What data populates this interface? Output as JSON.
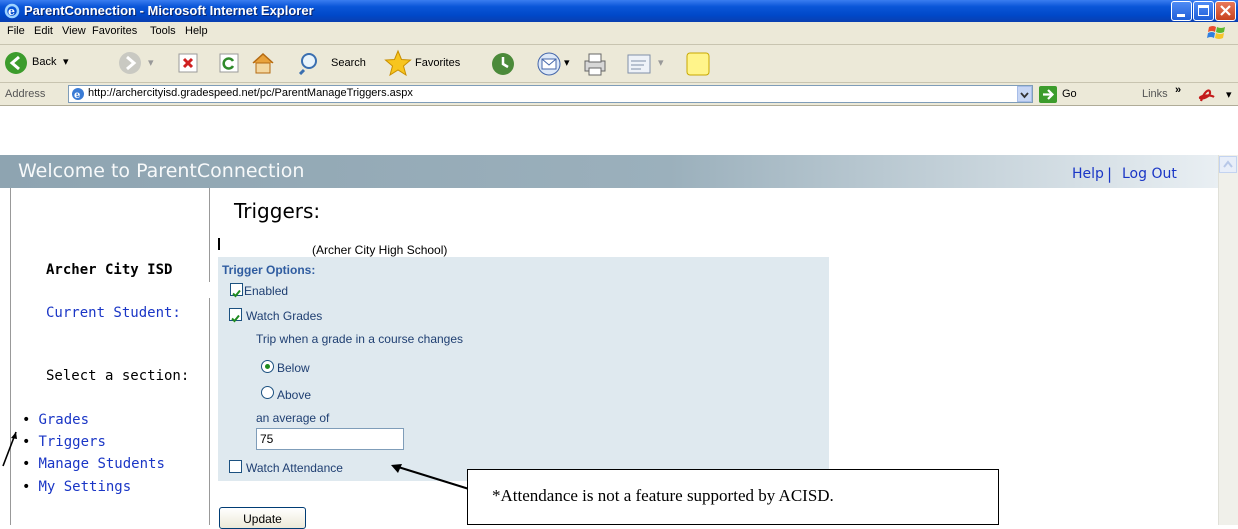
{
  "window": {
    "title": "ParentConnection - Microsoft Internet Explorer"
  },
  "menu": [
    "File",
    "Edit",
    "View",
    "Favorites",
    "Tools",
    "Help"
  ],
  "toolbar": {
    "back_label": "Back",
    "search_label": "Search",
    "favorites_label": "Favorites"
  },
  "address": {
    "label": "Address",
    "url": "http://archercityisd.gradespeed.net/pc/ParentManageTriggers.aspx",
    "go_label": "Go",
    "links_label": "Links"
  },
  "header": {
    "welcome": "Welcome to ParentConnection",
    "help": "Help",
    "separator": "|",
    "logout": "Log Out"
  },
  "sidebar": {
    "district": "Archer City ISD",
    "current_student_label": "Current Student:",
    "select_section": "Select a section:",
    "items": [
      {
        "label": "Grades"
      },
      {
        "label": "Triggers"
      },
      {
        "label": "Manage Students"
      },
      {
        "label": "My Settings"
      }
    ]
  },
  "main": {
    "title": "Triggers:",
    "school": "(Archer City High School)",
    "options_title": "Trigger Options:",
    "enabled_label": "Enabled",
    "enabled_checked": true,
    "watch_grades_label": "Watch Grades",
    "watch_grades_checked": true,
    "trip_text": "Trip when a grade in a course changes",
    "below_label": "Below",
    "below_selected": true,
    "above_label": "Above",
    "average_label": "an average of",
    "average_value": "75",
    "watch_attendance_label": "Watch Attendance",
    "watch_attendance_checked": false,
    "update_button": "Update"
  },
  "callout": {
    "text": "*Attendance is not a feature supported by ACISD."
  }
}
